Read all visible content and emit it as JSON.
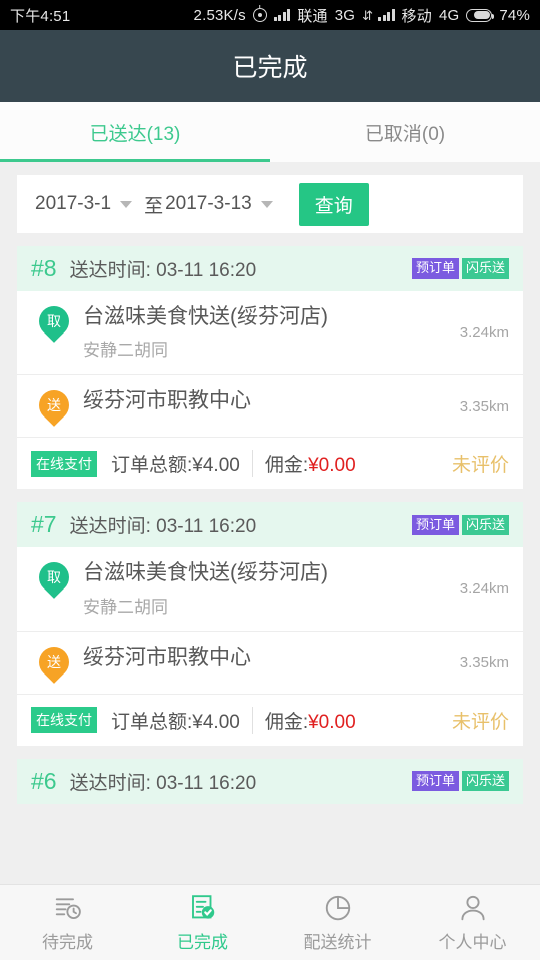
{
  "statusbar": {
    "time": "下午4:51",
    "netspeed": "2.53K/s",
    "carrier1": "联通",
    "net1": "3G",
    "carrier2": "移动",
    "net2": "4G",
    "battery": "74%",
    "icons": [
      "gps-icon",
      "signal-icon",
      "data-transfer-icon",
      "signal-icon",
      "battery-icon"
    ]
  },
  "header": {
    "title": "已完成"
  },
  "tabs": [
    {
      "label": "已送达(13)",
      "active": true
    },
    {
      "label": "已取消(0)",
      "active": false
    }
  ],
  "filter": {
    "date_from": "2017-3-1",
    "separator": "至",
    "date_to": "2017-3-13",
    "query_label": "查询",
    "accent": "#25C685"
  },
  "orders": [
    {
      "no": "#8",
      "time_label": "送达时间: 03-11 16:20",
      "badges": [
        {
          "text": "预订单",
          "color": "#7B5BE0"
        },
        {
          "text": "闪乐送",
          "color": "#3BC993"
        }
      ],
      "pickup": {
        "pin": "取",
        "name": "台滋味美食快送(绥芬河店)",
        "sub": "安静二胡同",
        "distance": "3.24km"
      },
      "dropoff": {
        "pin": "送",
        "name": "绥芬河市职教中心",
        "sub": "",
        "distance": "3.35km"
      },
      "pay_badge": "在线支付",
      "total": "订单总额:¥4.00",
      "fee_label": "佣金:",
      "fee_value": "¥0.00",
      "rating": "未评价"
    },
    {
      "no": "#7",
      "time_label": "送达时间: 03-11 16:20",
      "badges": [
        {
          "text": "预订单",
          "color": "#7B5BE0"
        },
        {
          "text": "闪乐送",
          "color": "#3BC993"
        }
      ],
      "pickup": {
        "pin": "取",
        "name": "台滋味美食快送(绥芬河店)",
        "sub": "安静二胡同",
        "distance": "3.24km"
      },
      "dropoff": {
        "pin": "送",
        "name": "绥芬河市职教中心",
        "sub": "",
        "distance": "3.35km"
      },
      "pay_badge": "在线支付",
      "total": "订单总额:¥4.00",
      "fee_label": "佣金:",
      "fee_value": "¥0.00",
      "rating": "未评价"
    },
    {
      "no": "#6",
      "time_label": "送达时间: 03-11 16:20",
      "badges": [
        {
          "text": "预订单",
          "color": "#7B5BE0"
        },
        {
          "text": "闪乐送",
          "color": "#3BC993"
        }
      ]
    }
  ],
  "bottomnav": [
    {
      "label": "待完成",
      "icon": "list-clock-icon",
      "active": false
    },
    {
      "label": "已完成",
      "icon": "document-check-icon",
      "active": true
    },
    {
      "label": "配送统计",
      "icon": "pie-chart-icon",
      "active": false
    },
    {
      "label": "个人中心",
      "icon": "person-icon",
      "active": false
    }
  ]
}
